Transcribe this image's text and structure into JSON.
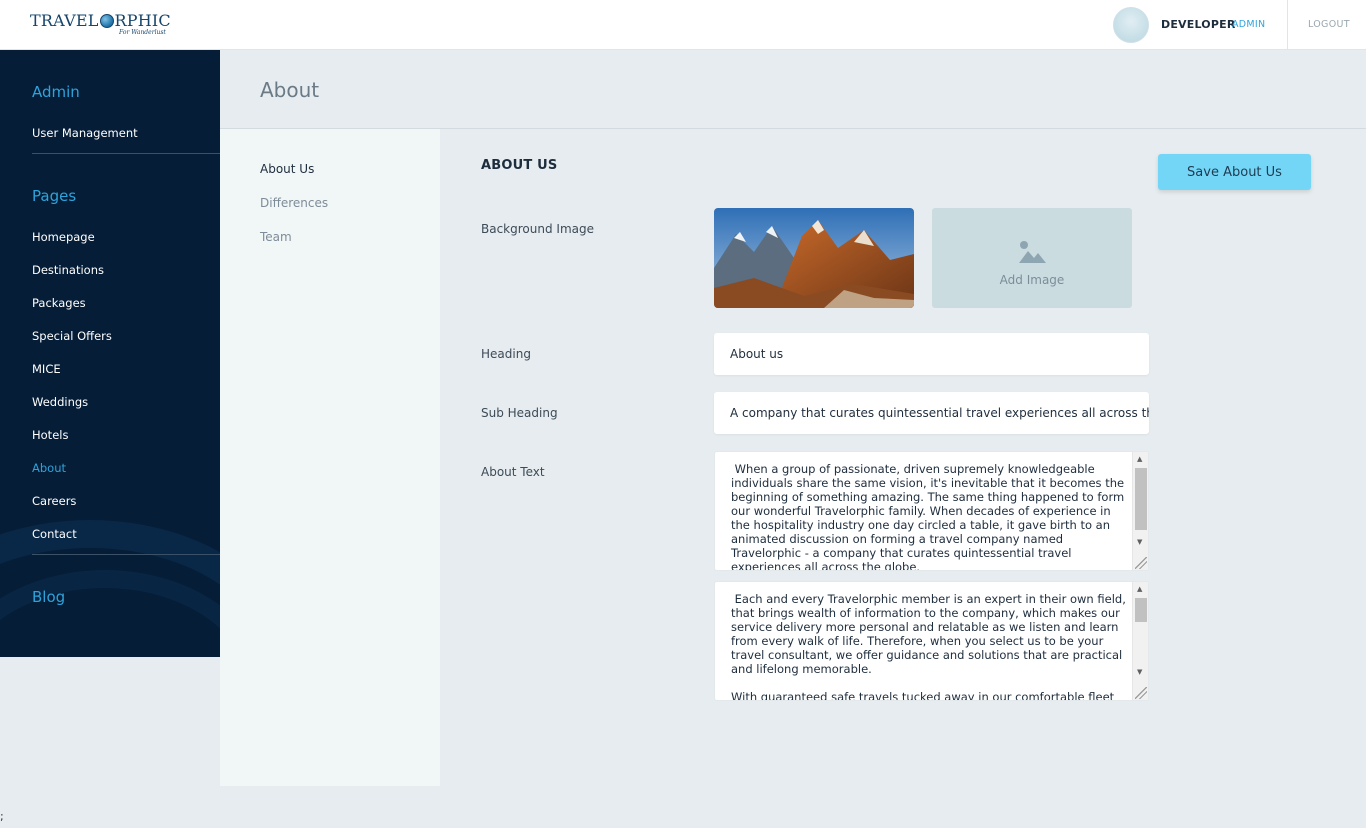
{
  "brand": {
    "name_before": "TRAVEL",
    "name_after": "RPHIC",
    "tagline": "For Wanderlust"
  },
  "user": {
    "name": "DEVELOPER",
    "role": "ADMIN",
    "logout_label": "LOGOUT"
  },
  "sidebar": {
    "admin_title": "Admin",
    "admin_items": [
      {
        "label": "User Management"
      }
    ],
    "pages_title": "Pages",
    "page_items": [
      {
        "label": "Homepage"
      },
      {
        "label": "Destinations"
      },
      {
        "label": "Packages"
      },
      {
        "label": "Special Offers"
      },
      {
        "label": "MICE"
      },
      {
        "label": "Weddings"
      },
      {
        "label": "Hotels"
      },
      {
        "label": "About",
        "active": true
      },
      {
        "label": "Careers"
      },
      {
        "label": "Contact"
      }
    ],
    "blog_title": "Blog"
  },
  "page": {
    "title": "About"
  },
  "subnav": [
    {
      "label": "About Us",
      "active": true
    },
    {
      "label": "Differences"
    },
    {
      "label": "Team"
    }
  ],
  "form": {
    "section_title": "ABOUT US",
    "save_label": "Save About Us",
    "background_image_label": "Background Image",
    "add_image_label": "Add Image",
    "heading_label": "Heading",
    "heading_value": "About us",
    "subheading_label": "Sub Heading",
    "subheading_value": "A company that curates quintessential travel experiences all across the",
    "about_text_label": "About Text",
    "about_text_1": " When a group of passionate, driven supremely knowledgeable individuals share the same vision, it's inevitable that it becomes the beginning of something amazing. The same thing happened to form our wonderful Travelorphic family. When decades of experience in the hospitality industry one day circled a table, it gave birth to an animated discussion on forming a travel company named Travelorphic - a company that curates quintessential travel experiences all across the globe.",
    "about_text_2": " Each and every Travelorphic member is an expert in their own field, that brings wealth of information to the company, which makes our service delivery more personal and relatable as we listen and learn from every walk of life. Therefore, when you select us to be your travel consultant, we offer guidance and solutions that are practical and lifelong memorable.\n\nWith guaranteed safe travels tucked away in our comfortable fleet"
  },
  "icons": {
    "add_image": "image-placeholder-icon",
    "scroll_up": "scroll-up-icon",
    "scroll_down": "scroll-down-icon"
  },
  "colors": {
    "sidebar_bg": "#051d37",
    "accent": "#2ea3db",
    "save_button": "#74d6f7",
    "page_bg": "#e6ecef"
  },
  "stray_text": ";"
}
